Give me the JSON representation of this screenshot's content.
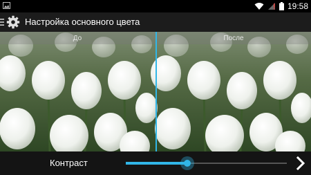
{
  "status_bar": {
    "time": "19:58",
    "icons": [
      "thumbnail-icon",
      "wifi-icon",
      "signal-icon",
      "battery-icon"
    ]
  },
  "action_bar": {
    "title": "Настройка основного цвета",
    "icons": [
      "menu-icon",
      "gear-icon"
    ]
  },
  "preview": {
    "before_label": "До",
    "after_label": "После",
    "accent_color": "#31b6e7"
  },
  "adjustment": {
    "label": "Контраст",
    "slider_value": 0.38,
    "next_icon": "chevron-right-icon"
  }
}
